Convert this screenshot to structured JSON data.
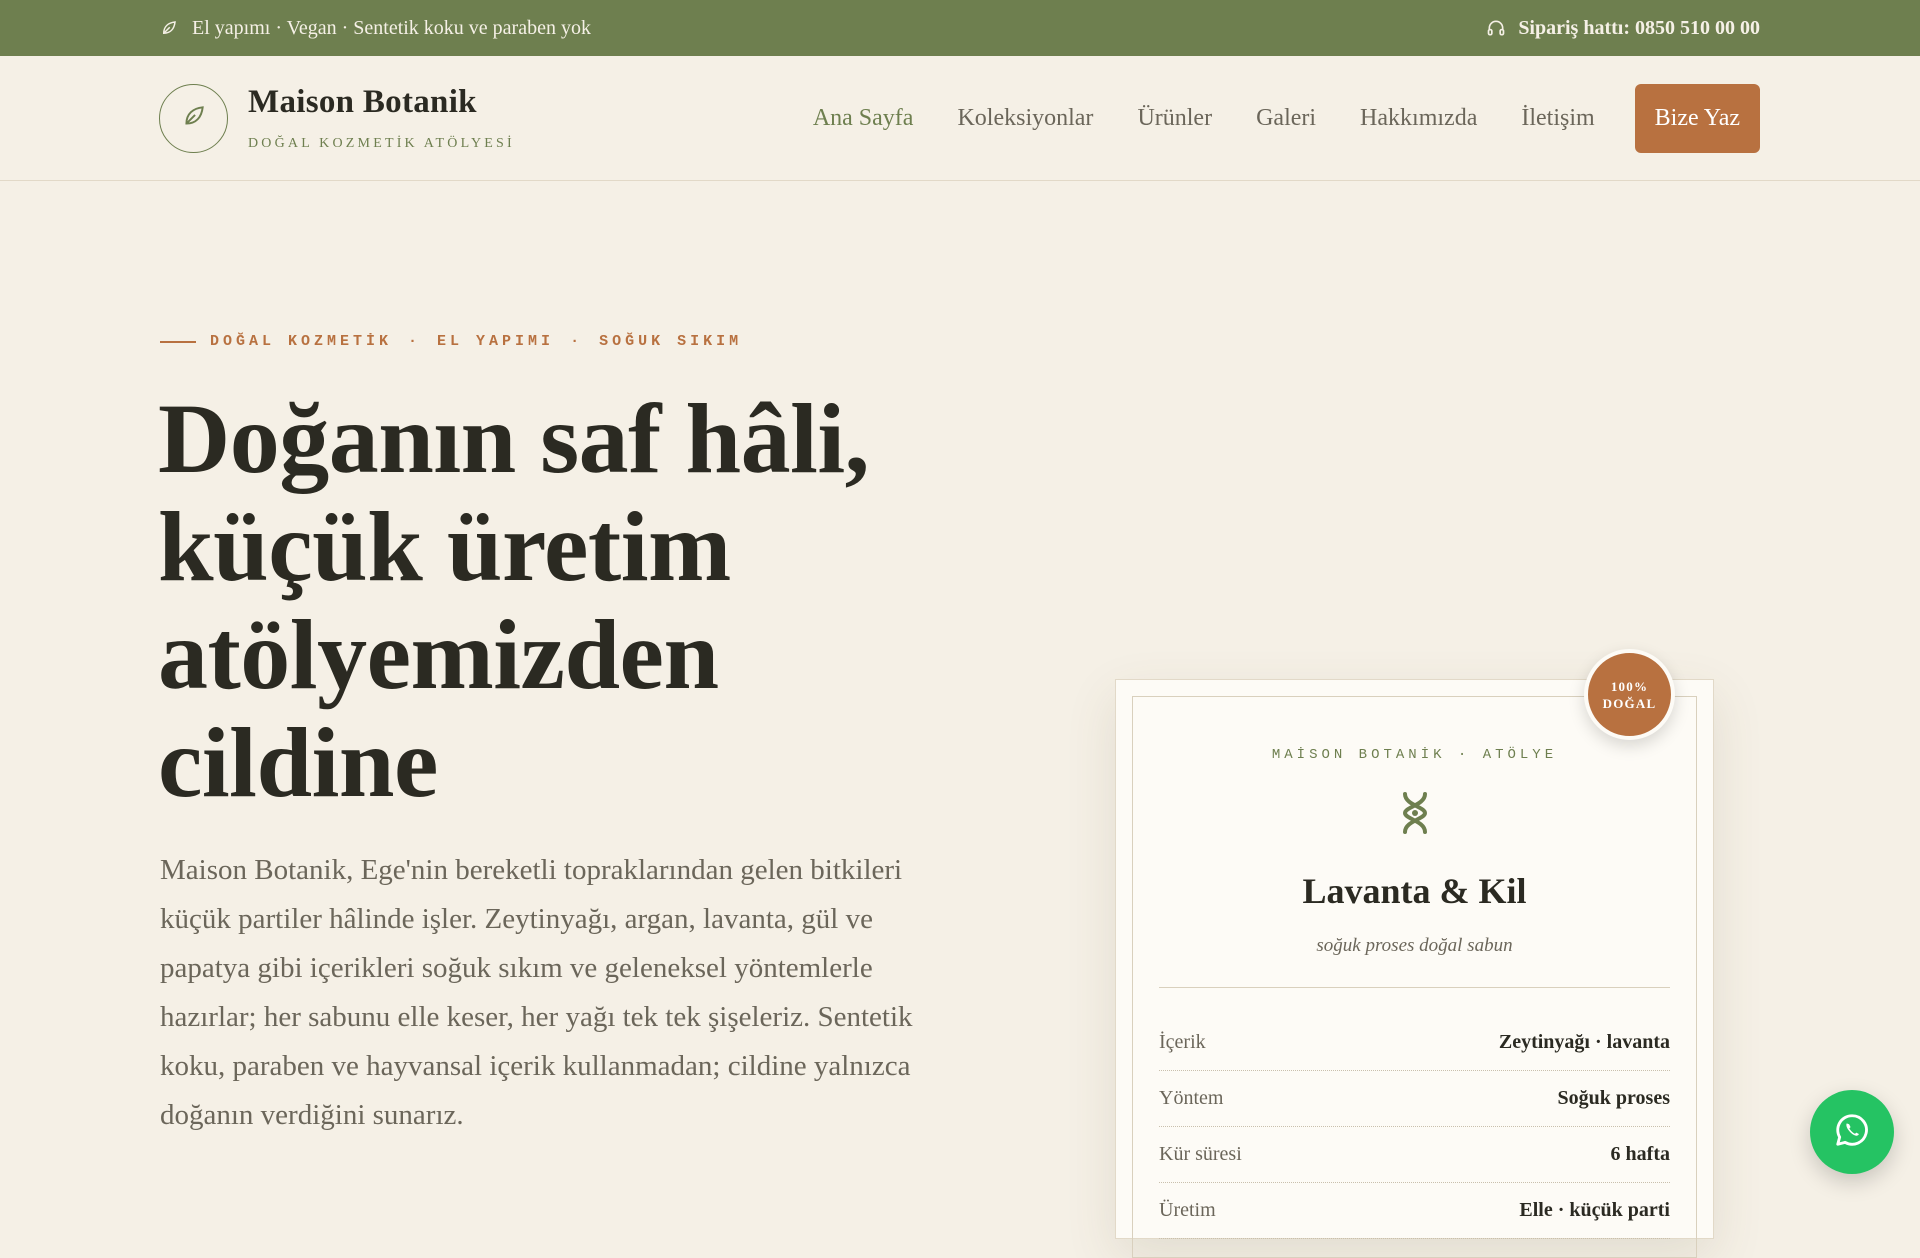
{
  "topbar": {
    "tagline": "El yapımı · Vegan · Sentetik koku ve paraben yok",
    "phone": "Sipariş hattı: 0850 510 00 00"
  },
  "header": {
    "brand_name": "Maison Botanik",
    "brand_tagline": "DOĞAL KOZMETİK ATÖLYESİ",
    "nav": [
      "Ana Sayfa",
      "Koleksiyonlar",
      "Ürünler",
      "Galeri",
      "Hakkımızda",
      "İletişim"
    ],
    "active_nav": "Ana Sayfa",
    "cta_label": "Bize Yaz"
  },
  "hero": {
    "eyebrow": [
      "DOĞAL KOZMETİK",
      "EL YAPIMI",
      "SOĞUK SIKIM"
    ],
    "title": "Doğanın saf hâli, küçük üretim atölyemizden cildine",
    "description": "Maison Botanik, Ege'nin bereketli topraklarından gelen bitkileri küçük partiler hâlinde işler. Zeytinyağı, argan, lavanta, gül ve papatya gibi içerikleri soğuk sıkım ve geleneksel yöntemlerle hazırlar; her sabunu elle keser, her yağı tek tek şişeleriz. Sentetik koku, paraben ve hayvansal içerik kullanmadan; cildine yalnızca doğanın verdiğini sunarız."
  },
  "product_card": {
    "brand_line": "MAİSON BOTANİK · ATÖLYE",
    "title": "Lavanta & Kil",
    "subtitle": "soğuk proses doğal sabun",
    "specs": [
      {
        "label": "İçerik",
        "value": "Zeytinyağı · lavanta"
      },
      {
        "label": "Yöntem",
        "value": "Soğuk proses"
      },
      {
        "label": "Kür süresi",
        "value": "6 hafta"
      },
      {
        "label": "Üretim",
        "value": "Elle · küçük parti"
      }
    ],
    "badge": {
      "line1": "100%",
      "line2": "DOĞAL"
    }
  },
  "colors": {
    "olive": "#6e7f4f",
    "terracotta": "#b87140",
    "cream": "#f5f0e6",
    "ink": "#2b2a22",
    "whatsapp": "#25c363"
  },
  "icons": {
    "topbar_left": "leaf-icon",
    "topbar_right": "headset-icon",
    "logo": "leaf-icon",
    "card": "botanical-knot-icon",
    "float": "whatsapp-icon"
  }
}
